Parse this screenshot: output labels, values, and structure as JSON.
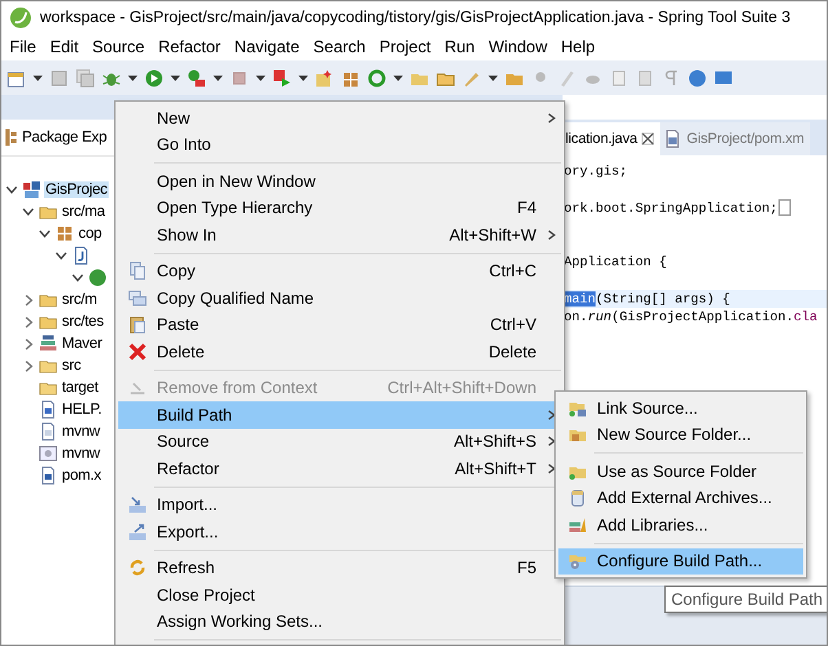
{
  "window": {
    "title": "workspace - GisProject/src/main/java/copycoding/tistory/gis/GisProjectApplication.java - Spring Tool Suite 3"
  },
  "menubar": [
    "File",
    "Edit",
    "Source",
    "Refactor",
    "Navigate",
    "Search",
    "Project",
    "Run",
    "Window",
    "Help"
  ],
  "explorer": {
    "tab": "Package Exp",
    "tree": [
      {
        "label": "GisProjec",
        "kind": "project",
        "selected": true,
        "expanded": true,
        "children": [
          {
            "label": "src/ma",
            "kind": "source-folder",
            "selected": false,
            "expanded": true,
            "children": [
              {
                "label": "cop",
                "kind": "package",
                "selected": false,
                "expanded": true,
                "children": [
                  {
                    "kind": "java-file",
                    "selected": false,
                    "expanded": true,
                    "children": [
                      {
                        "kind": "class",
                        "selected": false,
                        "expanded": true
                      }
                    ]
                  }
                ]
              }
            ]
          },
          {
            "label": "src/m",
            "kind": "source-folder",
            "selected": false,
            "expanded": false
          },
          {
            "label": "src/tes",
            "kind": "source-folder",
            "selected": false,
            "expanded": false
          },
          {
            "label": "Maver",
            "kind": "library",
            "selected": false,
            "expanded": false
          },
          {
            "label": "src",
            "kind": "folder",
            "selected": false,
            "expanded": false
          },
          {
            "label": "target",
            "kind": "folder",
            "selected": false
          },
          {
            "label": "HELP.",
            "kind": "doc",
            "selected": false
          },
          {
            "label": "mvnw",
            "kind": "text",
            "selected": false
          },
          {
            "label": "mvnw",
            "kind": "script",
            "selected": false
          },
          {
            "label": "pom.x",
            "kind": "maven",
            "selected": false
          }
        ]
      }
    ]
  },
  "editor": {
    "tabs": [
      {
        "label": "lication.java",
        "selected": true,
        "closable": true
      },
      {
        "label": "GisProject/pom.xm",
        "selected": false,
        "closable": false
      }
    ],
    "lines": [
      {
        "parts": [
          {
            "text": "ory.gis;"
          }
        ]
      },
      {
        "parts": [
          {
            "text": "ork.boot.SpringApplication;"
          }
        ],
        "folded": true
      },
      {
        "parts": [
          {
            "text": "Application {"
          }
        ]
      },
      {
        "parts": [
          {
            "text": "main",
            "selected": true
          },
          {
            "text": "(String[] args) {"
          }
        ],
        "current": true
      },
      {
        "parts": [
          {
            "text": "on."
          },
          {
            "text": "run",
            "italic": true
          },
          {
            "text": "(GisProjectApplication."
          },
          {
            "text": "cla",
            "field": true
          }
        ]
      }
    ]
  },
  "context_menu": [
    {
      "kind": "item",
      "label": "New",
      "submenu": true,
      "disabled": false,
      "selected": false
    },
    {
      "kind": "item",
      "label": "Go Into",
      "disabled": false,
      "selected": false
    },
    {
      "kind": "separator"
    },
    {
      "kind": "item",
      "label": "Open in New Window",
      "disabled": false,
      "selected": false
    },
    {
      "kind": "item",
      "label": "Open Type Hierarchy",
      "shortcut": "F4",
      "disabled": false,
      "selected": false
    },
    {
      "kind": "item",
      "label": "Show In",
      "shortcut": "Alt+Shift+W",
      "submenu": true,
      "disabled": false,
      "selected": false
    },
    {
      "kind": "separator"
    },
    {
      "kind": "item",
      "label": "Copy",
      "shortcut": "Ctrl+C",
      "disabled": false,
      "selected": false
    },
    {
      "kind": "item",
      "label": "Copy Qualified Name",
      "disabled": false,
      "selected": false
    },
    {
      "kind": "item",
      "label": "Paste",
      "shortcut": "Ctrl+V",
      "disabled": false,
      "selected": false
    },
    {
      "kind": "item",
      "label": "Delete",
      "shortcut": "Delete",
      "disabled": false,
      "selected": false
    },
    {
      "kind": "separator"
    },
    {
      "kind": "item",
      "label": "Remove from Context",
      "shortcut": "Ctrl+Alt+Shift+Down",
      "disabled": true,
      "selected": false
    },
    {
      "kind": "item",
      "label": "Build Path",
      "submenu": true,
      "disabled": false,
      "selected": true
    },
    {
      "kind": "item",
      "label": "Source",
      "shortcut": "Alt+Shift+S",
      "submenu": true,
      "disabled": false,
      "selected": false
    },
    {
      "kind": "item",
      "label": "Refactor",
      "shortcut": "Alt+Shift+T",
      "submenu": true,
      "disabled": false,
      "selected": false
    },
    {
      "kind": "separator"
    },
    {
      "kind": "item",
      "label": "Import...",
      "disabled": false,
      "selected": false
    },
    {
      "kind": "item",
      "label": "Export...",
      "disabled": false,
      "selected": false
    },
    {
      "kind": "separator"
    },
    {
      "kind": "item",
      "label": "Refresh",
      "shortcut": "F5",
      "disabled": false,
      "selected": false
    },
    {
      "kind": "item",
      "label": "Close Project",
      "disabled": false,
      "selected": false
    },
    {
      "kind": "item",
      "label": "Assign Working Sets...",
      "disabled": false,
      "selected": false
    },
    {
      "kind": "separator"
    }
  ],
  "submenu": [
    {
      "kind": "item",
      "label": "Link Source...",
      "selected": false
    },
    {
      "kind": "item",
      "label": "New Source Folder...",
      "selected": false
    },
    {
      "kind": "separator"
    },
    {
      "kind": "item",
      "label": "Use as Source Folder",
      "selected": false
    },
    {
      "kind": "item",
      "label": "Add External Archives...",
      "selected": false
    },
    {
      "kind": "item",
      "label": "Add Libraries...",
      "selected": false
    },
    {
      "kind": "separator"
    },
    {
      "kind": "item",
      "label": "Configure Build Path...",
      "selected": true
    }
  ],
  "tooltip": "Configure Build Path"
}
